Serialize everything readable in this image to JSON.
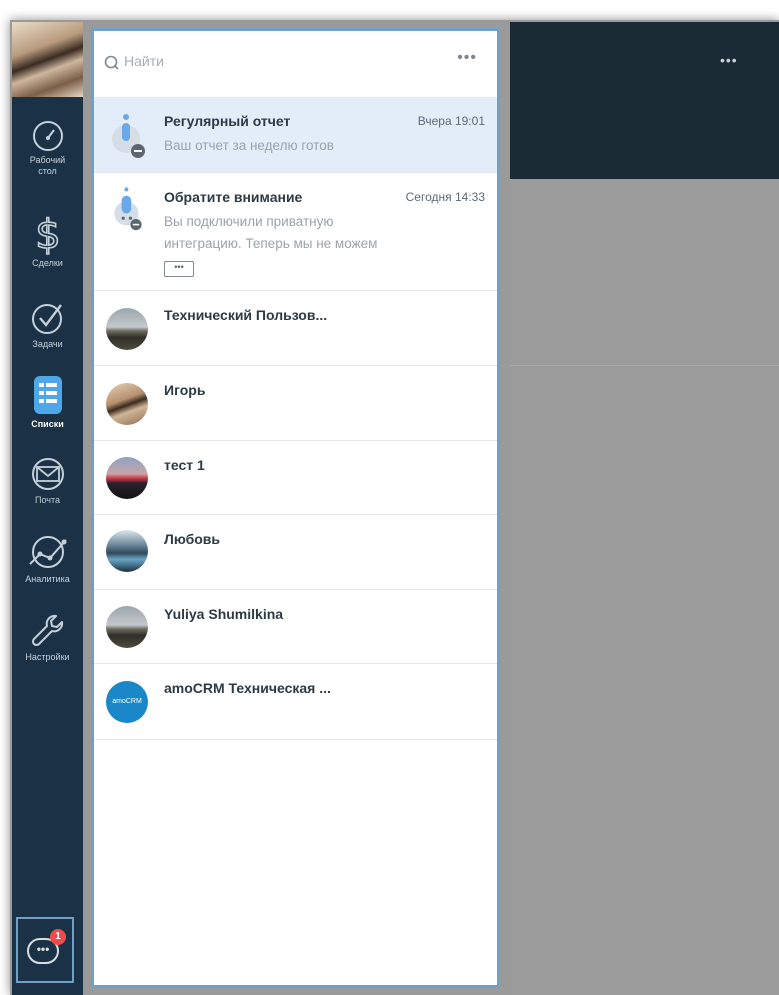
{
  "nav": {
    "items": [
      {
        "label_line1": "Рабочий",
        "label_line2": "стол",
        "icon": "dashboard-gauge-icon"
      },
      {
        "label_line1": "Сделки",
        "label_line2": "",
        "icon": "deals-dollar-icon"
      },
      {
        "label_line1": "Задачи",
        "label_line2": "",
        "icon": "tasks-check-icon"
      },
      {
        "label_line1": "Списки",
        "label_line2": "",
        "icon": "lists-icon",
        "active": true
      },
      {
        "label_line1": "Почта",
        "label_line2": "",
        "icon": "mail-icon"
      },
      {
        "label_line1": "Аналитика",
        "label_line2": "",
        "icon": "analytics-icon"
      },
      {
        "label_line1": "Настройки",
        "label_line2": "",
        "icon": "settings-wrench-icon"
      }
    ],
    "chat_badge": "1",
    "chat_bubble": "•••"
  },
  "search": {
    "placeholder": "Найти",
    "more": "•••"
  },
  "chats": [
    {
      "name": "Регулярный отчет",
      "time": "Вчера 19:01",
      "msg": "Ваш отчет за неделю готов"
    },
    {
      "name": "Обратите внимание",
      "time": "Сегодня 14:33",
      "msg": "Вы подключили приватную интеграцию. Теперь мы не можем",
      "more": "•••"
    },
    {
      "name": "Технический Пользов..."
    },
    {
      "name": "Игорь"
    },
    {
      "name": "тест 1"
    },
    {
      "name": "Любовь"
    },
    {
      "name": "Yuliya Shumilkina"
    },
    {
      "name": "amoCRM Техническая ...",
      "avatar_text": "amoCRM"
    }
  ],
  "right": {
    "more": "•••"
  },
  "colors": {
    "nav_bg": "#1b3246",
    "accent_border": "#6ea1c7",
    "highlight_row": "#e3edfa",
    "badge": "#f04b4b"
  }
}
